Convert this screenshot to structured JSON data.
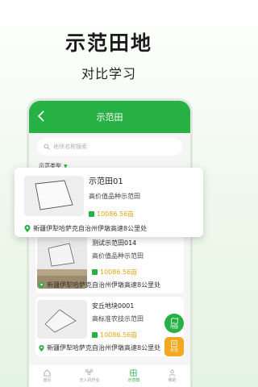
{
  "promo": {
    "title": "示范田地",
    "subtitle": "对比学习"
  },
  "app": {
    "title": "示范田",
    "search_placeholder": "地块名称搜索",
    "filter_label": "示范类型"
  },
  "fields": [
    {
      "name": "示范田01",
      "type": "高价值品种示范田",
      "area": "10086.56亩",
      "address": "新疆伊犁哈萨克自治州伊墩高速8公里处"
    },
    {
      "name": "测试示范田014",
      "type": "高价值品种示范田",
      "area": "10086.56亩",
      "address": "新疆伊犁哈萨克自治州伊墩高速8公里处"
    },
    {
      "name": "安丘地块0001",
      "type": "高标准农技示范田",
      "area": "10086.56亩",
      "address": "新疆伊犁哈萨克自治州伊墩高速8公里处"
    }
  ],
  "fabs": [
    {
      "label": "地图"
    },
    {
      "label": "示范"
    }
  ],
  "tabs": [
    {
      "label": "首页",
      "icon": "home-icon",
      "active": false
    },
    {
      "label": "无人机作业",
      "icon": "drone-icon",
      "active": false
    },
    {
      "label": "示范田",
      "icon": "field-icon",
      "active": true
    },
    {
      "label": "我的",
      "icon": "user-icon",
      "active": false
    }
  ],
  "colors": {
    "primary": "#27b043",
    "area_text": "#e3a419",
    "fab_orange": "#f2a81f"
  }
}
